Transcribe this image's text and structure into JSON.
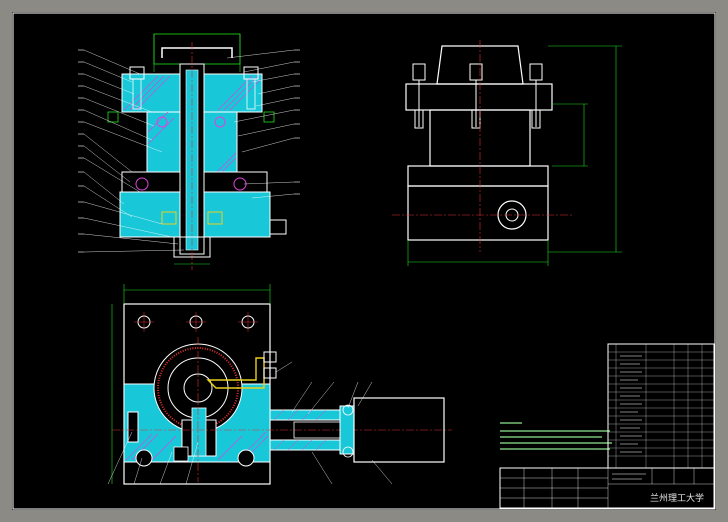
{
  "drawing": {
    "institution": "兰州理工大学",
    "background": "#000000",
    "colors": {
      "outline": "#ffffff",
      "section_fill": "#18c8d8",
      "hatch": "#e040e0",
      "center_line": "#e03030",
      "dimension": "#20e020",
      "title_block": "#ffffff",
      "notes": "#8fe88f"
    }
  }
}
